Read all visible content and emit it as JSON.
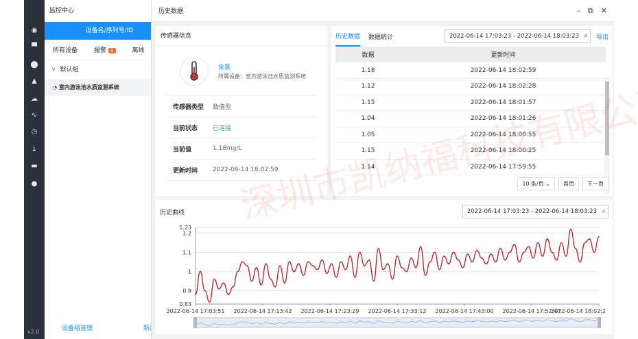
{
  "app": {
    "version": "v2.0",
    "title": "监控中心"
  },
  "device_panel": {
    "search_label": "设备名/序列号/ID",
    "tabs": [
      {
        "label": "所有设备"
      },
      {
        "label": "报警",
        "badge": "0"
      },
      {
        "label": "离线"
      }
    ],
    "group": "默认组",
    "device": "室内游泳池水质监测系统",
    "footer": {
      "left": "设备组管理",
      "right": "新建设备"
    }
  },
  "window": {
    "title": "历史数据"
  },
  "sensor": {
    "title": "传感器信息",
    "name": "余氯",
    "owner": "所属设备：室内游泳池水质监测系统",
    "rows": [
      {
        "key": "传感器类型",
        "value": "数值型"
      },
      {
        "key": "当前状态",
        "value": "已连接"
      },
      {
        "key": "当前值",
        "value": "1.18mg/L"
      },
      {
        "key": "更新时间",
        "value": "2022-06-14 18:02:59"
      }
    ]
  },
  "history": {
    "tabs": [
      "历史数据",
      "数据统计"
    ],
    "range": "2022-06-14 17:03:23 - 2022-06-14 18:03:23",
    "export": "导出",
    "columns": [
      "数据",
      "更新时间"
    ],
    "rows": [
      [
        "1.18",
        "2022-06-14 18:02:59"
      ],
      [
        "1.12",
        "2022-06-14 18:02:28"
      ],
      [
        "1.15",
        "2022-06-14 18:01:57"
      ],
      [
        "1.04",
        "2022-06-14 18:01:26"
      ],
      [
        "1.05",
        "2022-06-14 18:00:55"
      ],
      [
        "1.15",
        "2022-06-14 18:00:25"
      ],
      [
        "1.14",
        "2022-06-14 17:59:55"
      ]
    ],
    "page_size": "10 条/页",
    "first": "首页",
    "next": "下一页"
  },
  "curve": {
    "title": "历史曲线",
    "range": "2022-06-14 17:03:23 - 2022-06-14 18:03:23"
  },
  "chart_data": {
    "type": "line",
    "ylim": [
      0.83,
      1.23
    ],
    "yticks": [
      "1.23",
      "1.2",
      "1.1",
      "1",
      "0.9",
      "0.83"
    ],
    "xticks": [
      "2022-06-14 17:03:51",
      "2022-06-14 17:13:42",
      "2022-06-14 17:23:29",
      "2022-06-14 17:33:12",
      "2022-06-14 17:43:00",
      "2022-06-14 17:52:47",
      "2022-06-14 18:02:2"
    ],
    "color": "#b22222",
    "values": [
      0.88,
      1.0,
      0.9,
      0.84,
      0.96,
      0.91,
      0.94,
      0.88,
      0.92,
      1.0,
      1.05,
      1.03,
      0.95,
      1.02,
      0.93,
      1.04,
      0.96,
      0.92,
      1.03,
      0.94,
      1.05,
      1.0,
      1.04,
      0.98,
      1.05,
      1.03,
      1.01,
      1.06,
      0.99,
      1.04,
      0.97,
      1.05,
      1.01,
      1.08,
      0.97,
      1.1,
      1.03,
      1.06,
      0.95,
      1.12,
      1.01,
      1.04,
      0.96,
      1.08,
      1.02,
      1.0,
      1.07,
      1.02,
      1.13,
      0.98,
      1.05,
      1.1,
      1.01,
      1.08,
      1.04,
      1.1,
      1.06,
      1.02,
      1.09,
      1.05,
      1.11,
      1.07,
      1.04,
      1.09,
      1.05,
      1.12,
      1.06,
      1.1,
      1.14,
      1.05,
      1.1,
      1.13,
      1.07,
      1.15,
      1.08,
      1.17,
      1.1,
      1.06,
      1.15,
      1.08,
      1.22,
      1.12,
      1.05,
      1.15,
      1.17,
      1.1,
      1.18
    ]
  },
  "watermark": "深圳市凯纳福科技有限公司"
}
